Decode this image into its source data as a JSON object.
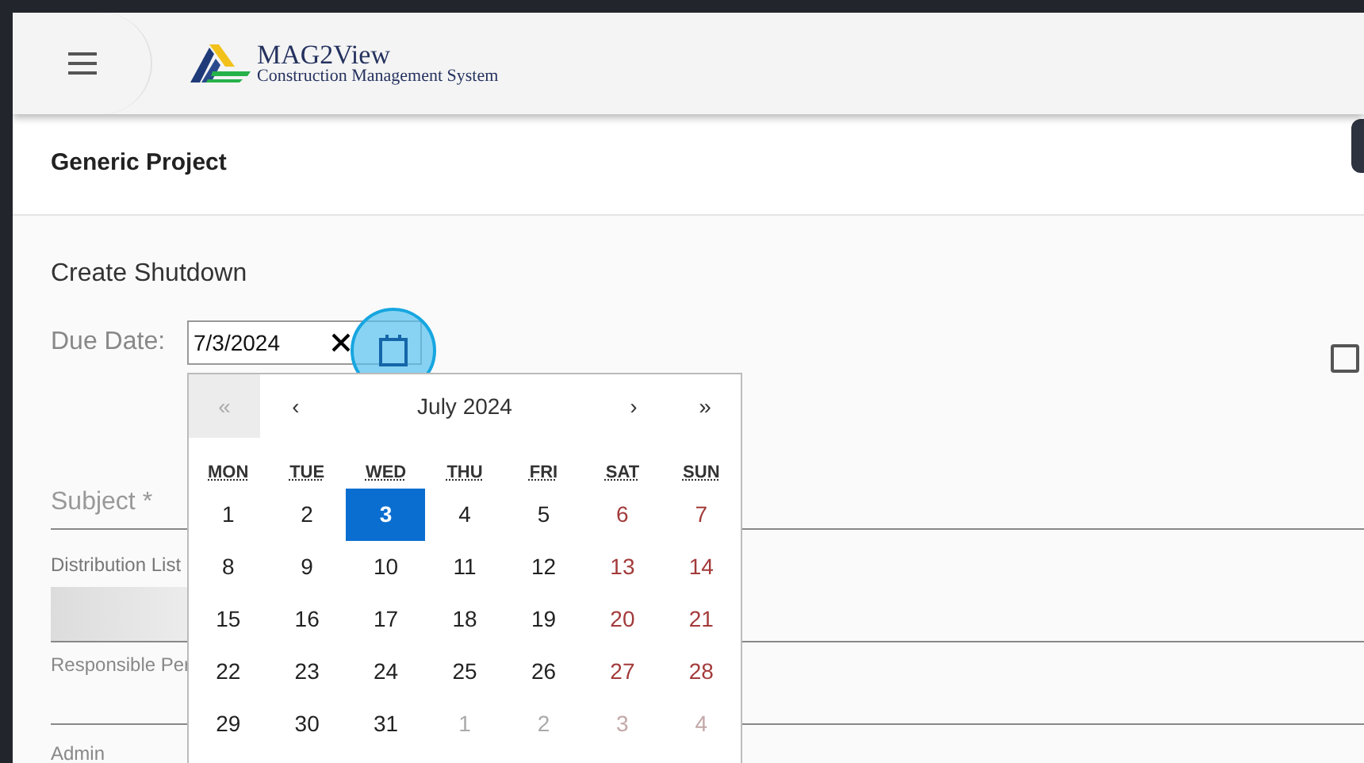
{
  "header": {
    "logo_title": "MAG2View",
    "logo_subtitle": "Construction Management System"
  },
  "project": {
    "title": "Generic Project"
  },
  "form": {
    "title": "Create Shutdown",
    "due_date": {
      "label": "Due Date:",
      "value": "7/3/2024"
    },
    "checkbox": {
      "checked": false
    },
    "subject": {
      "placeholder": "Subject *"
    },
    "distribution_list": {
      "label": "Distribution List"
    },
    "responsible_person": {
      "label": "Responsible Per"
    },
    "admin": {
      "label": "Admin"
    }
  },
  "datepicker": {
    "title": "July 2024",
    "nav": [
      "«",
      "‹",
      "›",
      "»"
    ],
    "weekdays": [
      "MON",
      "TUE",
      "WED",
      "THU",
      "FRI",
      "SAT",
      "SUN"
    ],
    "weeks": [
      [
        {
          "day": "1",
          "selected": false,
          "weekend": false,
          "outside": false
        },
        {
          "day": "2",
          "selected": false,
          "weekend": false,
          "outside": false
        },
        {
          "day": "3",
          "selected": true,
          "weekend": false,
          "outside": false
        },
        {
          "day": "4",
          "selected": false,
          "weekend": false,
          "outside": false
        },
        {
          "day": "5",
          "selected": false,
          "weekend": false,
          "outside": false
        },
        {
          "day": "6",
          "selected": false,
          "weekend": true,
          "outside": false
        },
        {
          "day": "7",
          "selected": false,
          "weekend": true,
          "outside": false
        }
      ],
      [
        {
          "day": "8",
          "selected": false,
          "weekend": false,
          "outside": false
        },
        {
          "day": "9",
          "selected": false,
          "weekend": false,
          "outside": false
        },
        {
          "day": "10",
          "selected": false,
          "weekend": false,
          "outside": false
        },
        {
          "day": "11",
          "selected": false,
          "weekend": false,
          "outside": false
        },
        {
          "day": "12",
          "selected": false,
          "weekend": false,
          "outside": false
        },
        {
          "day": "13",
          "selected": false,
          "weekend": true,
          "outside": false
        },
        {
          "day": "14",
          "selected": false,
          "weekend": true,
          "outside": false
        }
      ],
      [
        {
          "day": "15",
          "selected": false,
          "weekend": false,
          "outside": false
        },
        {
          "day": "16",
          "selected": false,
          "weekend": false,
          "outside": false
        },
        {
          "day": "17",
          "selected": false,
          "weekend": false,
          "outside": false
        },
        {
          "day": "18",
          "selected": false,
          "weekend": false,
          "outside": false
        },
        {
          "day": "19",
          "selected": false,
          "weekend": false,
          "outside": false
        },
        {
          "day": "20",
          "selected": false,
          "weekend": true,
          "outside": false
        },
        {
          "day": "21",
          "selected": false,
          "weekend": true,
          "outside": false
        }
      ],
      [
        {
          "day": "22",
          "selected": false,
          "weekend": false,
          "outside": false
        },
        {
          "day": "23",
          "selected": false,
          "weekend": false,
          "outside": false
        },
        {
          "day": "24",
          "selected": false,
          "weekend": false,
          "outside": false
        },
        {
          "day": "25",
          "selected": false,
          "weekend": false,
          "outside": false
        },
        {
          "day": "26",
          "selected": false,
          "weekend": false,
          "outside": false
        },
        {
          "day": "27",
          "selected": false,
          "weekend": true,
          "outside": false
        },
        {
          "day": "28",
          "selected": false,
          "weekend": true,
          "outside": false
        }
      ],
      [
        {
          "day": "29",
          "selected": false,
          "weekend": false,
          "outside": false
        },
        {
          "day": "30",
          "selected": false,
          "weekend": false,
          "outside": false
        },
        {
          "day": "31",
          "selected": false,
          "weekend": false,
          "outside": false
        },
        {
          "day": "1",
          "selected": false,
          "weekend": false,
          "outside": true
        },
        {
          "day": "2",
          "selected": false,
          "weekend": false,
          "outside": true
        },
        {
          "day": "3",
          "selected": false,
          "weekend": true,
          "outside": true
        },
        {
          "day": "4",
          "selected": false,
          "weekend": true,
          "outside": true
        }
      ]
    ]
  }
}
